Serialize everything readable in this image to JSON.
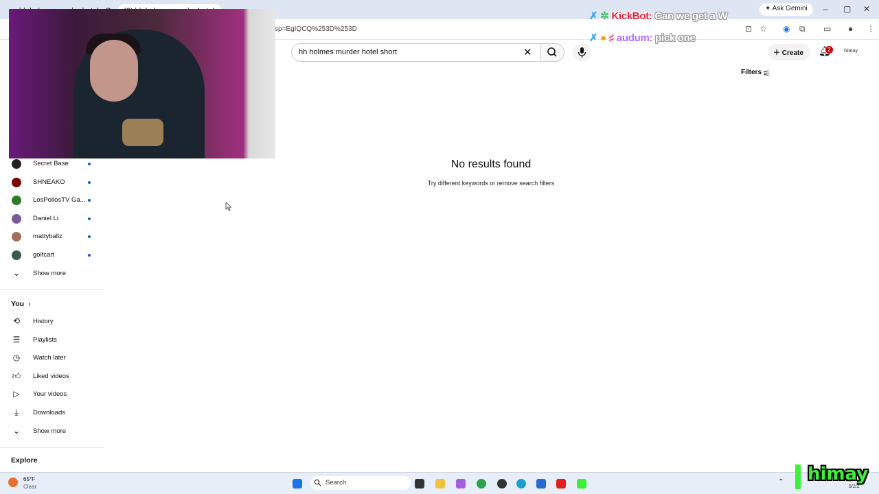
{
  "browser": {
    "tabs": [
      "hh holmes murder hotel - Go",
      "(2) hh holmes murder hotel s"
    ],
    "url": "sp=EgIQCQ%253D%253D",
    "ask_gemini": "Ask Gemini",
    "window_controls": [
      "–",
      "▢",
      "✕"
    ]
  },
  "masthead": {
    "search_query": "hh holmes murder hotel short",
    "create_label": "Create",
    "notification_count": "2",
    "account_label": "himay",
    "filters_label": "Filters"
  },
  "results": {
    "title": "No results found",
    "subtitle": "Try different keywords or remove search filters"
  },
  "sidebar": {
    "subscriptions": [
      {
        "label": "Secret Base",
        "color": "#222222"
      },
      {
        "label": "SHNEAKO",
        "color": "#7a0a0a"
      },
      {
        "label": "LosPollosTV Ga...",
        "color": "#2f7a2f"
      },
      {
        "label": "Daniel Li",
        "color": "#7a5a9a"
      },
      {
        "label": "mattyballz",
        "color": "#a0705a"
      },
      {
        "label": "golfcart",
        "color": "#3a5a4a"
      }
    ],
    "show_more_1": "Show more",
    "you_heading": "You",
    "you_items": [
      {
        "label": "History",
        "icon": "history-icon"
      },
      {
        "label": "Playlists",
        "icon": "playlists-icon"
      },
      {
        "label": "Watch later",
        "icon": "clock-icon"
      },
      {
        "label": "Liked videos",
        "icon": "thumbs-up-icon"
      },
      {
        "label": "Your videos",
        "icon": "video-icon"
      },
      {
        "label": "Downloads",
        "icon": "download-icon"
      }
    ],
    "show_more_2": "Show more",
    "explore_heading": "Explore"
  },
  "chat": [
    {
      "user": "KickBot:",
      "message": "Can we get a W"
    },
    {
      "user": "audum:",
      "message": "pick one"
    }
  ],
  "taskbar": {
    "weather_temp": "65°F",
    "weather_cond": "Clear",
    "search_label": "Search",
    "tray_date": "5/2/2"
  },
  "overlay_logo": "himay",
  "colors": {
    "youtube_red": "#cc0000",
    "link_blue": "#065fd4",
    "kick_green": "#3df03a"
  }
}
